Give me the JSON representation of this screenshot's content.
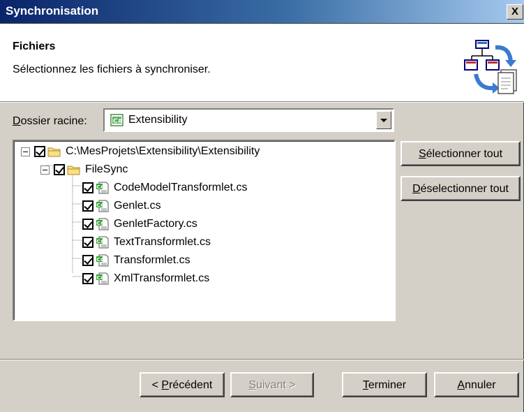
{
  "window": {
    "title": "Synchronisation",
    "close_glyph": "X"
  },
  "header": {
    "title": "Fichiers",
    "subtitle": "Sélectionnez les fichiers à synchroniser.",
    "icon": "sync-files-icon"
  },
  "root_folder": {
    "label_accel": "D",
    "label_rest": "ossier racine:",
    "selected_value": "Extensibility"
  },
  "tree": {
    "root": {
      "label": "C:\\MesProjets\\Extensibility\\Extensibility",
      "checked": true,
      "expanded": true
    },
    "folder": {
      "label": "FileSync",
      "checked": true,
      "expanded": true
    },
    "files": [
      {
        "label": "CodeModelTransformlet.cs",
        "checked": true
      },
      {
        "label": "Genlet.cs",
        "checked": true
      },
      {
        "label": "GenletFactory.cs",
        "checked": true
      },
      {
        "label": "TextTransformlet.cs",
        "checked": true
      },
      {
        "label": "Transformlet.cs",
        "checked": true
      },
      {
        "label": "XmlTransformlet.cs",
        "checked": true
      }
    ]
  },
  "side_buttons": {
    "select_all_accel": "S",
    "select_all_rest": "électionner tout",
    "deselect_all_accel": "D",
    "deselect_all_rest": "éselectionner tout"
  },
  "footer_buttons": {
    "previous_pre": "< ",
    "previous_accel": "P",
    "previous_rest": "récédent",
    "next_accel": "S",
    "next_rest": "uivant >",
    "finish_accel": "T",
    "finish_rest": "erminer",
    "cancel_accel": "A",
    "cancel_rest": "nnuler"
  },
  "colors": {
    "titlebar_start": "#0a246a",
    "titlebar_end": "#a6caf0",
    "dialog_face": "#d4d0c8"
  }
}
